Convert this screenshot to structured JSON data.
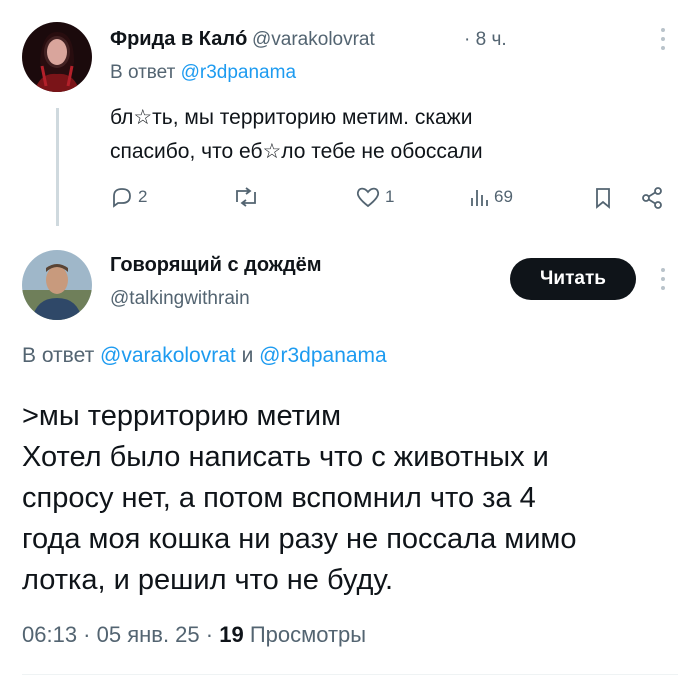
{
  "tweet1": {
    "name": "Фрида в Калó",
    "handle": "@varakolovrat",
    "time": "· 8 ч.",
    "reply_prefix": "В ответ",
    "reply_to": "@r3dpanama",
    "text_line1": "бл☆ть, мы территорию метим. скажи",
    "text_line2": "спасибо, что еб☆ло тебе не обоссали",
    "actions": {
      "replies": "2",
      "reposts": "",
      "likes": "1",
      "views": "69"
    }
  },
  "tweet2": {
    "name": "Говорящий с дождём",
    "handle": "@talkingwithrain",
    "follow_label": "Читать",
    "reply_prefix": "В ответ",
    "reply_to_1": "@varakolovrat",
    "reply_joiner": "и",
    "reply_to_2": "@r3dpanama",
    "text_lines": [
      ">мы территорию метим",
      "Хотел было написать что с животных и",
      "спросу нет, а потом вспомнил что за 4",
      "года моя кошка ни разу не поссала мимо",
      "лотка, и решил что не буду."
    ],
    "timestamp": "06:13 · 05 янв. 25 ·",
    "views_count": "19",
    "views_label": "Просмотры"
  },
  "icons": [
    "reply-icon",
    "repost-icon",
    "like-icon",
    "views-icon",
    "bookmark-icon",
    "share-icon",
    "more-icon"
  ]
}
